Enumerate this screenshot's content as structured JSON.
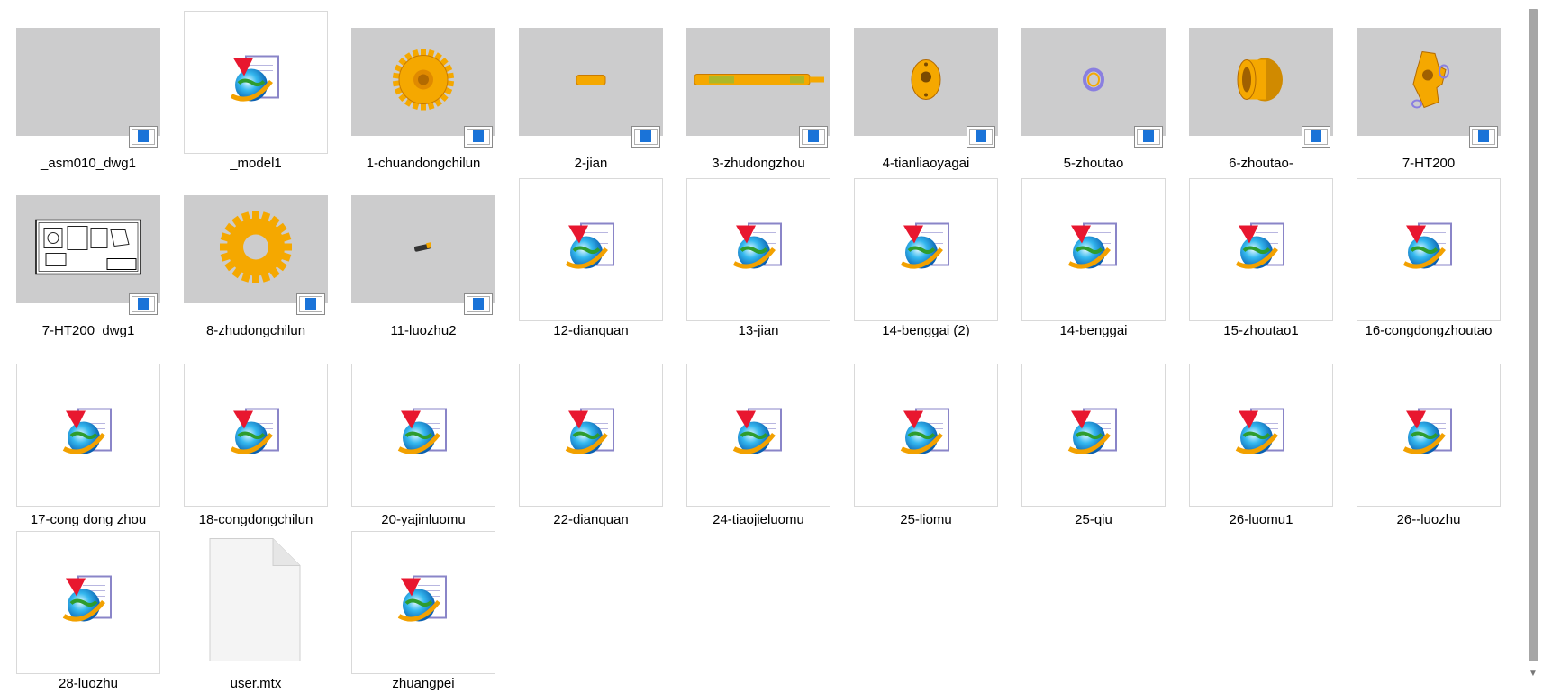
{
  "files": [
    {
      "name": "_asm010_dwg1",
      "thumb": "blank-gray",
      "badge": true
    },
    {
      "name": "_model1",
      "thumb": "ie-doc",
      "badge": false
    },
    {
      "name": "1-chuandongchilun",
      "thumb": "gear",
      "badge": true
    },
    {
      "name": "2-jian",
      "thumb": "key",
      "badge": true
    },
    {
      "name": "3-zhudongzhou",
      "thumb": "shaft",
      "badge": true
    },
    {
      "name": "4-tianliaoyagai",
      "thumb": "flange",
      "badge": true
    },
    {
      "name": "5-zhoutao",
      "thumb": "ring",
      "badge": true
    },
    {
      "name": "6-zhoutao-",
      "thumb": "bushing",
      "badge": true
    },
    {
      "name": "7-HT200",
      "thumb": "housing",
      "badge": true
    },
    {
      "name": "7-HT200_dwg1",
      "thumb": "drawing",
      "badge": true
    },
    {
      "name": "8-zhudongchilun",
      "thumb": "gear-big",
      "badge": true
    },
    {
      "name": "11-luozhu2",
      "thumb": "pin",
      "badge": true
    },
    {
      "name": "12-dianquan",
      "thumb": "ie-doc",
      "badge": false
    },
    {
      "name": "13-jian",
      "thumb": "ie-doc",
      "badge": false
    },
    {
      "name": "14-benggai (2)",
      "thumb": "ie-doc",
      "badge": false
    },
    {
      "name": "14-benggai",
      "thumb": "ie-doc",
      "badge": false
    },
    {
      "name": "15-zhoutao1",
      "thumb": "ie-doc",
      "badge": false
    },
    {
      "name": "16-congdongzhoutao",
      "thumb": "ie-doc",
      "badge": false
    },
    {
      "name": "17-cong dong zhou",
      "thumb": "ie-doc",
      "badge": false
    },
    {
      "name": "18-congdongchilun",
      "thumb": "ie-doc",
      "badge": false
    },
    {
      "name": "20-yajinluomu",
      "thumb": "ie-doc",
      "badge": false
    },
    {
      "name": "22-dianquan",
      "thumb": "ie-doc",
      "badge": false
    },
    {
      "name": "24-tiaojieluomu",
      "thumb": "ie-doc",
      "badge": false
    },
    {
      "name": "25-liomu",
      "thumb": "ie-doc",
      "badge": false
    },
    {
      "name": "25-qiu",
      "thumb": "ie-doc",
      "badge": false
    },
    {
      "name": "26-luomu1",
      "thumb": "ie-doc",
      "badge": false
    },
    {
      "name": "26--luozhu",
      "thumb": "ie-doc",
      "badge": false
    },
    {
      "name": "28-luozhu",
      "thumb": "ie-doc",
      "badge": false
    },
    {
      "name": "user.mtx",
      "thumb": "generic-file",
      "badge": false
    },
    {
      "name": "zhuangpei",
      "thumb": "ie-doc",
      "badge": false
    }
  ],
  "colors": {
    "part": "#f5a800",
    "thumb_bg": "#cccccd",
    "badge_blue": "#1a73d8"
  }
}
